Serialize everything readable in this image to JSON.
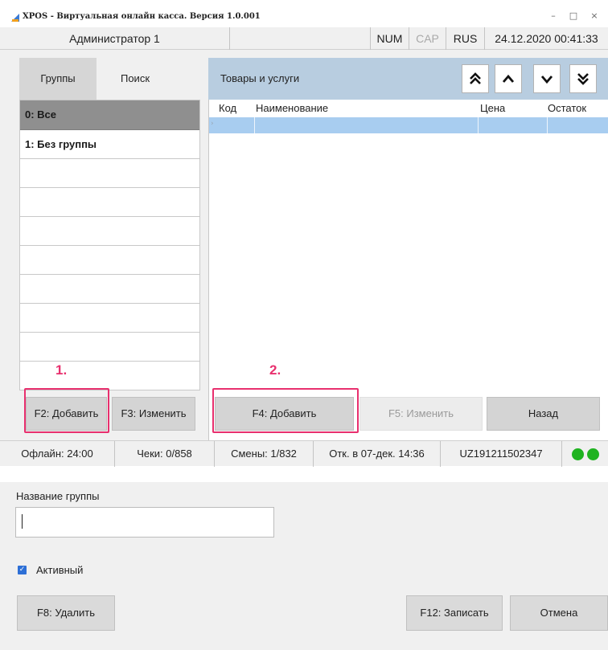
{
  "window": {
    "title": "XPOS - Виртуальная онлайн касса. Версия 1.0.001",
    "icon": "app-icon"
  },
  "header": {
    "operator": "Администратор 1",
    "num": "NUM",
    "cap": "CAP",
    "lang": "RUS",
    "datetime": "24.12.2020 00:41:33"
  },
  "tabs": [
    {
      "label": "Группы"
    },
    {
      "label": "Поиск"
    }
  ],
  "groups": [
    {
      "label": "0: Все"
    },
    {
      "label": "1: Без группы"
    }
  ],
  "goods": {
    "title": "Товары и услуги",
    "columns": [
      "Код",
      "Наименование",
      "Цена",
      "Остаток"
    ]
  },
  "nav_icons": [
    "double-up-icon",
    "up-icon",
    "down-icon",
    "double-down-icon"
  ],
  "group_buttons": {
    "add": "F2: Добавить",
    "edit": "F3: Изменить"
  },
  "goods_buttons": {
    "add": "F4: Добавить",
    "edit": "F5: Изменить",
    "back": "Назад"
  },
  "annotations": {
    "step1": "1.",
    "step2": "2.",
    "color": "#e8306e"
  },
  "statusbar": {
    "offline": "Офлайн: 24:00",
    "receipts": "Чеки: 0/858",
    "shifts": "Смены: 1/832",
    "opened": "Отк. в 07-дек. 14:36",
    "serial": "UZ191211502347",
    "indicator_color": "#1fb320"
  },
  "dialog": {
    "name_label": "Название группы",
    "name_value": "",
    "active_label": "Активный",
    "active_checked": true,
    "delete": "F8: Удалить",
    "save": "F12: Записать",
    "cancel": "Отмена"
  }
}
